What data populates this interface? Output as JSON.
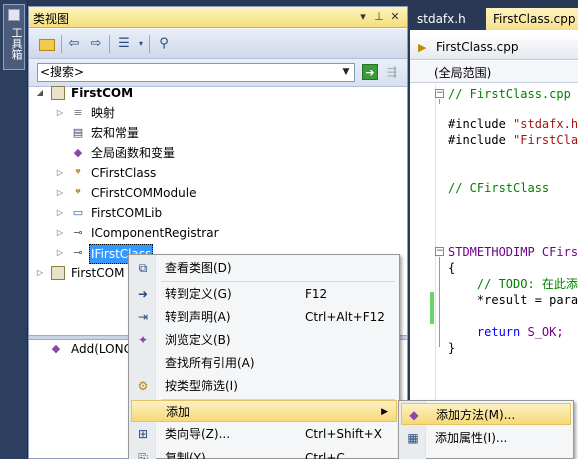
{
  "toolbox": {
    "label": "工具箱"
  },
  "class_view": {
    "title": "类视图",
    "title_buttons": {
      "dropdown": "▾",
      "pin": "⊥",
      "close": "✕"
    },
    "search_placeholder": "<搜索>",
    "tree": [
      {
        "label": "FirstCOM",
        "bold": true
      },
      {
        "label": "映射"
      },
      {
        "label": "宏和常量"
      },
      {
        "label": "全局函数和变量"
      },
      {
        "label": "CFirstClass"
      },
      {
        "label": "CFirstCOMModule"
      },
      {
        "label": "FirstCOMLib"
      },
      {
        "label": "IComponentRegistrar"
      },
      {
        "label": "IFirstClass",
        "selected": true
      },
      {
        "label": "FirstCOM"
      }
    ],
    "members": [
      {
        "label": "Add(LONG"
      }
    ]
  },
  "editor": {
    "tabs": [
      {
        "label": "stdafx.h"
      },
      {
        "label": "FirstClass.cpp",
        "active": true
      }
    ],
    "file": "FirstClass.cpp",
    "scope": "(全局范围)",
    "code": {
      "l1": "// FirstClass.cpp",
      "l2a": "#include ",
      "l2b": "\"stdafx.h\"",
      "l3a": "#include ",
      "l3b": "\"FirstClass",
      "l4": "// CFirstClass",
      "l5": "STDMETHODIMP CFirst",
      "l6": "{",
      "l7": "    // TODO: 在此添",
      "l8": "    *result = para",
      "l9a": "    return ",
      "l9b": "S_OK;",
      "l10": "}"
    }
  },
  "context_menu": {
    "items": [
      {
        "label": "查看类图(D)",
        "icon": "class-diagram-icon"
      },
      {
        "label": "转到定义(G)",
        "shortcut": "F12",
        "icon": "goto-definition-icon"
      },
      {
        "label": "转到声明(A)",
        "shortcut": "Ctrl+Alt+F12",
        "icon": "goto-declaration-icon"
      },
      {
        "label": "浏览定义(B)",
        "icon": "browse-definition-icon"
      },
      {
        "label": "查找所有引用(A)"
      },
      {
        "label": "按类型筛选(I)",
        "icon": "filter-icon"
      },
      {
        "label": "添加",
        "arrow": "▶"
      },
      {
        "label": "类向导(Z)...",
        "shortcut": "Ctrl+Shift+X",
        "icon": "class-wizard-icon"
      },
      {
        "label": "复制(Y)",
        "shortcut": "Ctrl+C",
        "icon": "copy-icon"
      }
    ]
  },
  "submenu": {
    "items": [
      {
        "label": "添加方法(M)...",
        "icon": "add-method-icon"
      },
      {
        "label": "添加属性(I)...",
        "icon": "add-property-icon"
      }
    ]
  }
}
